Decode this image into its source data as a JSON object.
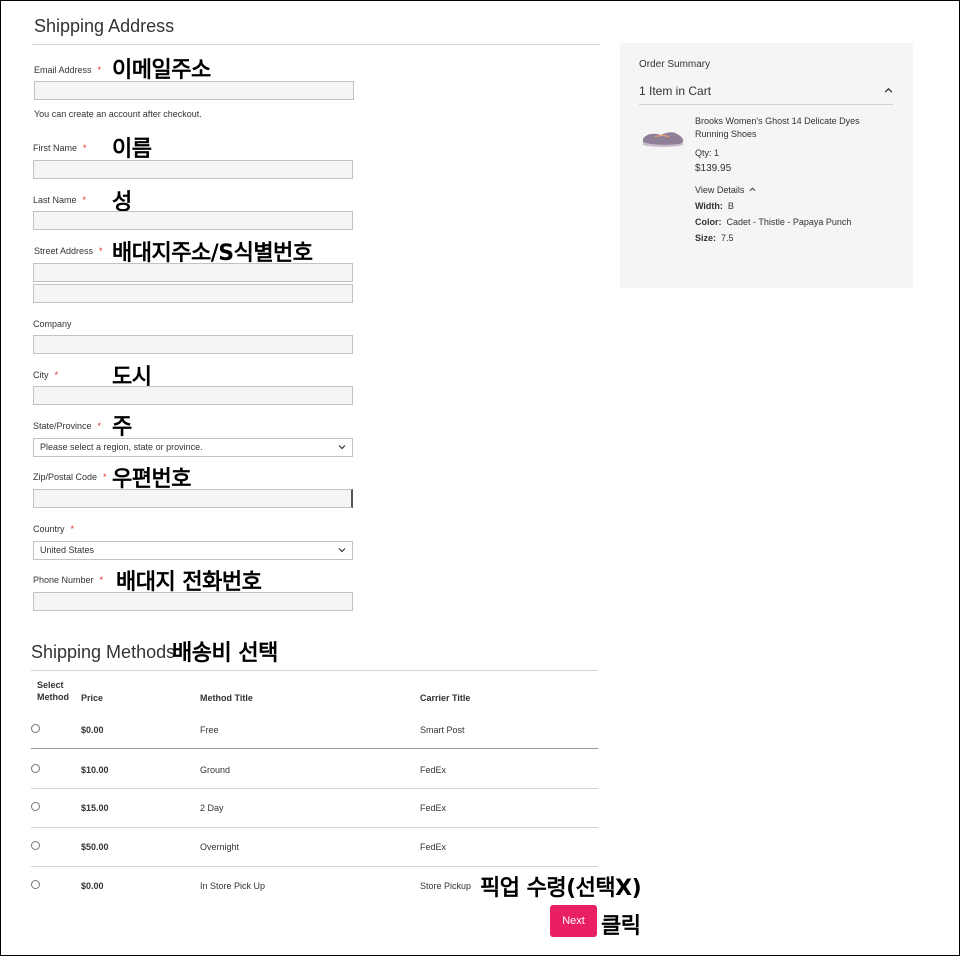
{
  "shipping_address": {
    "title": "Shipping Address",
    "email": {
      "label": "Email Address",
      "required": "*",
      "value": "",
      "note": "You can create an account after checkout.",
      "annotation": "이메일주소"
    },
    "first_name": {
      "label": "First Name",
      "required": "*",
      "value": "",
      "annotation": "이름"
    },
    "last_name": {
      "label": "Last Name",
      "required": "*",
      "value": "",
      "annotation": "성"
    },
    "street": {
      "label": "Street Address",
      "required": "*",
      "value1": "",
      "value2": "",
      "annotation": "배대지주소/S식별번호"
    },
    "company": {
      "label": "Company",
      "value": ""
    },
    "city": {
      "label": "City",
      "required": "*",
      "value": "",
      "annotation": "도시"
    },
    "state": {
      "label": "State/Province",
      "required": "*",
      "selected": "Please select a region, state or province.",
      "annotation": "주"
    },
    "zip": {
      "label": "Zip/Postal Code",
      "required": "*",
      "value": "",
      "annotation": "우편번호"
    },
    "country": {
      "label": "Country",
      "required": "*",
      "selected": "United States"
    },
    "phone": {
      "label": "Phone Number",
      "required": "*",
      "value": "",
      "annotation": "배대지 전화번호"
    }
  },
  "order_summary": {
    "title": "Order Summary",
    "items_in_cart": "1 Item in Cart",
    "product_name_line1": "Brooks Women's Ghost 14 Delicate Dyes",
    "product_name_line2": "Running Shoes",
    "qty": "Qty: 1",
    "price": "$139.95",
    "view_details": "View Details",
    "width_label": "Width:",
    "width_value": "B",
    "color_label": "Color:",
    "color_value": "Cadet - Thistle - Papaya Punch",
    "size_label": "Size:",
    "size_value": "7.5"
  },
  "shipping_methods": {
    "title": "Shipping Methods",
    "annotation": "배송비 선택",
    "headers": {
      "select_line1": "Select",
      "select_line2": "Method",
      "price": "Price",
      "method_title": "Method Title",
      "carrier_title": "Carrier Title"
    },
    "rows": [
      {
        "price": "$0.00",
        "method": "Free",
        "carrier": "Smart Post"
      },
      {
        "price": "$10.00",
        "method": "Ground",
        "carrier": "FedEx"
      },
      {
        "price": "$15.00",
        "method": "2 Day",
        "carrier": "FedEx"
      },
      {
        "price": "$50.00",
        "method": "Overnight",
        "carrier": "FedEx"
      },
      {
        "price": "$0.00",
        "method": "In Store Pick Up",
        "carrier": "Store Pickup"
      }
    ],
    "pickup_annotation": "픽업 수령(선택X)"
  },
  "next_button": {
    "label": "Next",
    "annotation": "클릭"
  },
  "colors": {
    "accent": "#e91e63",
    "required": "#e02b27",
    "panel_bg": "#f5f5f5"
  },
  "icons": [
    "chevron-down-icon",
    "chevron-up-icon",
    "shoe-image"
  ]
}
